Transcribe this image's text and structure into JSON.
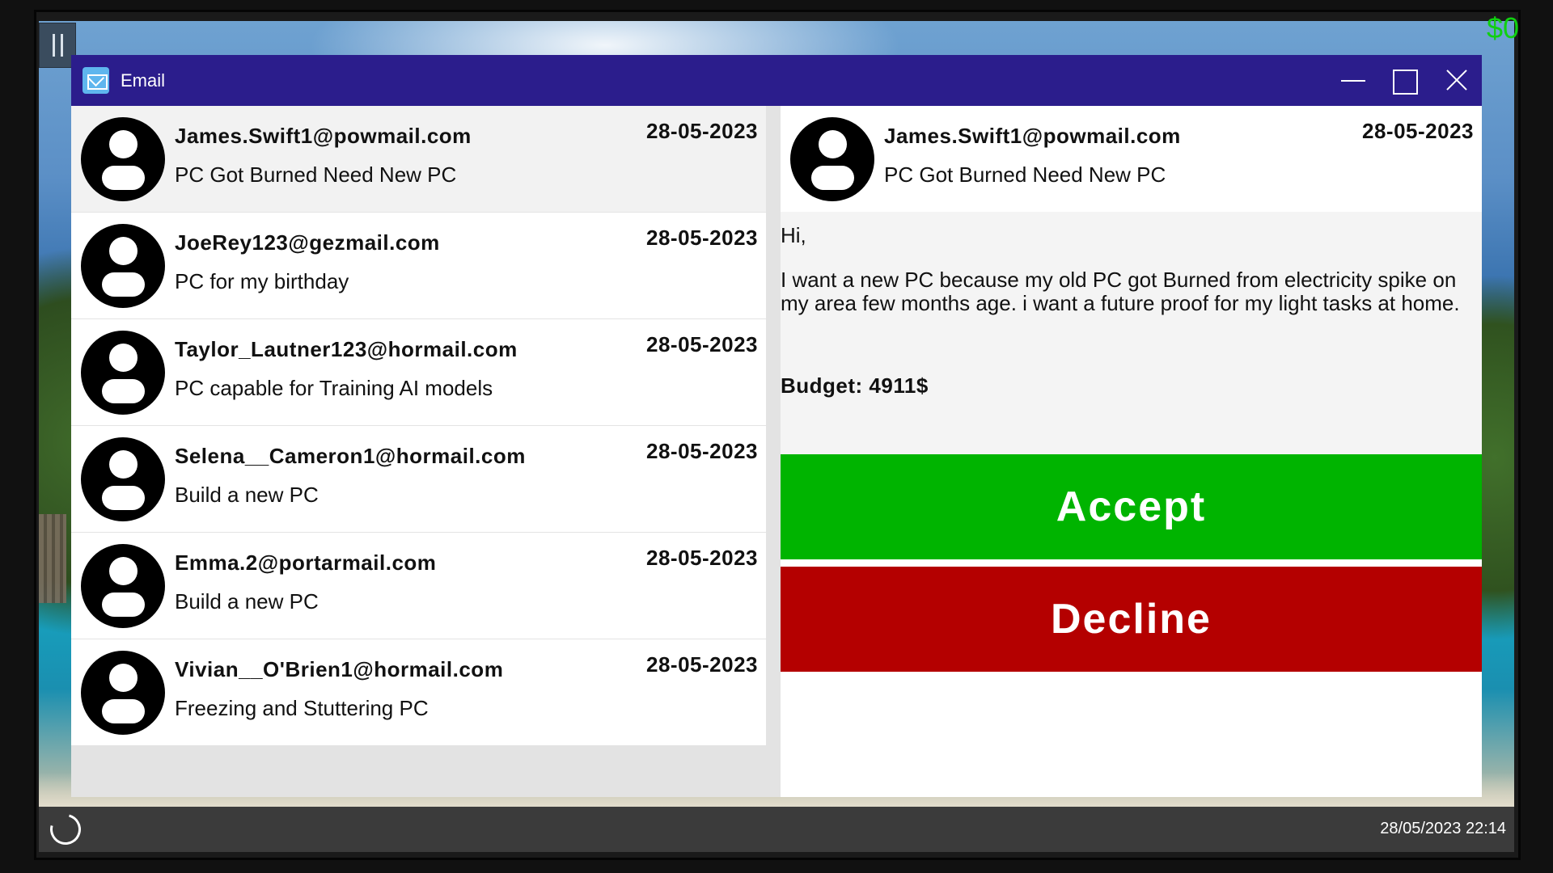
{
  "hud": {
    "money": "$0"
  },
  "window": {
    "title": "Email"
  },
  "inbox": [
    {
      "sender": "James.Swift1@powmail.com",
      "subject": "PC Got Burned Need New PC",
      "date": "28-05-2023"
    },
    {
      "sender": "JoeRey123@gezmail.com",
      "subject": "PC for my birthday",
      "date": "28-05-2023"
    },
    {
      "sender": "Taylor_Lautner123@hormail.com",
      "subject": "PC capable for Training AI models",
      "date": "28-05-2023"
    },
    {
      "sender": "Selena__Cameron1@hormail.com",
      "subject": "Build a new PC",
      "date": "28-05-2023"
    },
    {
      "sender": "Emma.2@portarmail.com",
      "subject": "Build a new PC",
      "date": "28-05-2023"
    },
    {
      "sender": "Vivian__O'Brien1@hormail.com",
      "subject": "Freezing and Stuttering PC",
      "date": "28-05-2023"
    }
  ],
  "reader": {
    "sender": "James.Swift1@powmail.com",
    "subject": "PC Got Burned Need New PC",
    "date": "28-05-2023",
    "greeting": "Hi,",
    "message": "I want a new PC because my old PC got Burned from electricity spike on my area few months age. i want a future proof for my light tasks at home.",
    "budget": "Budget: 4911$",
    "accept_label": "Accept",
    "decline_label": "Decline"
  },
  "taskbar": {
    "clock": "28/05/2023 22:14"
  },
  "colors": {
    "titlebar": "#2b1d8c",
    "accept": "#00b400",
    "decline": "#b40000",
    "money": "#10d010"
  }
}
